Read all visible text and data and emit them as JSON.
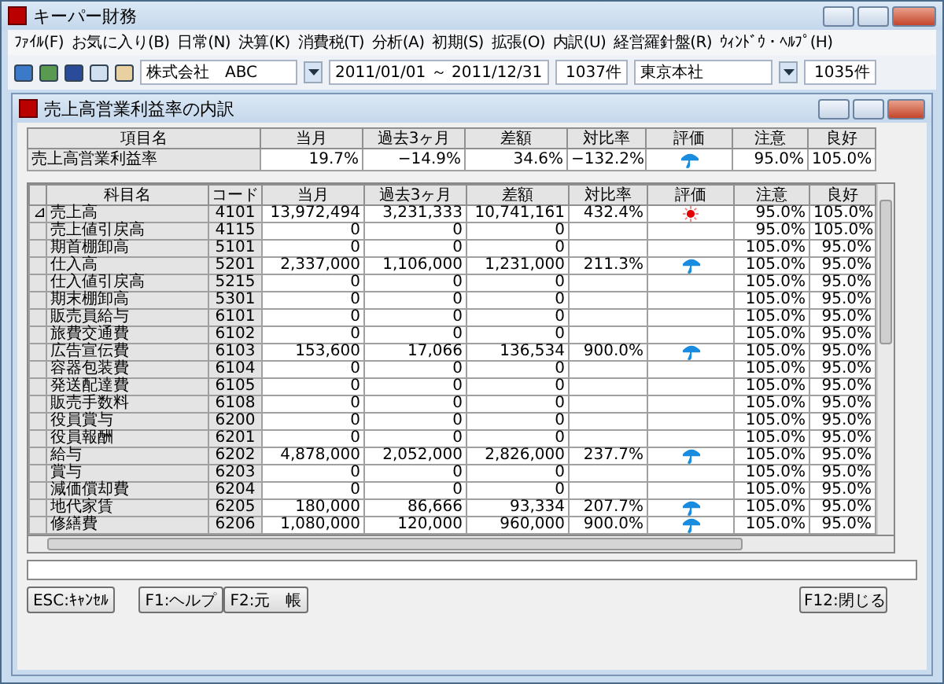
{
  "window": {
    "title": "キーパー財務"
  },
  "menu": [
    "ﾌｧｲﾙ(F)",
    "お気に入り(B)",
    "日常(N)",
    "決算(K)",
    "消費税(T)",
    "分析(A)",
    "初期(S)",
    "拡張(O)",
    "内訳(U)",
    "経営羅針盤(R)",
    "ｳｨﾝﾄﾞｳ・ﾍﾙﾌﾟ(H)"
  ],
  "toolbar": {
    "company": "株式会社　ABC",
    "period": "2011/01/01 ～ 2011/12/31",
    "count_1": "1037件",
    "branch": "東京本社",
    "count_2": "1035件"
  },
  "child_window": {
    "title": "売上高営業利益率の内訳"
  },
  "summary": {
    "columns": [
      "項目名",
      "当月",
      "過去3ヶ月",
      "差額",
      "対比率",
      "評価",
      "注意",
      "良好"
    ],
    "row": {
      "name": "売上高営業利益率",
      "current": "19.7%",
      "past3": "−14.9%",
      "diff": "34.6%",
      "ratio": "−132.2%",
      "kind": "rain",
      "caution": "95.0%",
      "good": "105.0%"
    }
  },
  "table": {
    "columns": [
      "科目名",
      "コード",
      "当月",
      "過去3ヶ月",
      "差額",
      "対比率",
      "評価",
      "注意",
      "良好"
    ],
    "rows": [
      {
        "marker": "⊿",
        "name": "売上高",
        "code": "4101",
        "current": "13,972,494",
        "past3": "3,231,333",
        "diff": "10,741,161",
        "ratio": "432.4%",
        "kind": "sun",
        "caution": "95.0%",
        "good": "105.0%"
      },
      {
        "name": "売上値引戻高",
        "code": "4115",
        "current": "0",
        "past3": "0",
        "diff": "0",
        "caution": "95.0%",
        "good": "105.0%"
      },
      {
        "name": "期首棚卸高",
        "code": "5101",
        "current": "0",
        "past3": "0",
        "diff": "0",
        "caution": "105.0%",
        "good": "95.0%"
      },
      {
        "name": "仕入高",
        "code": "5201",
        "current": "2,337,000",
        "past3": "1,106,000",
        "diff": "1,231,000",
        "ratio": "211.3%",
        "kind": "rain",
        "caution": "105.0%",
        "good": "95.0%"
      },
      {
        "name": "仕入値引戻高",
        "code": "5215",
        "current": "0",
        "past3": "0",
        "diff": "0",
        "caution": "105.0%",
        "good": "95.0%"
      },
      {
        "name": "期末棚卸高",
        "code": "5301",
        "current": "0",
        "past3": "0",
        "diff": "0",
        "caution": "105.0%",
        "good": "95.0%"
      },
      {
        "name": "販売員給与",
        "code": "6101",
        "current": "0",
        "past3": "0",
        "diff": "0",
        "caution": "105.0%",
        "good": "95.0%"
      },
      {
        "name": "旅費交通費",
        "code": "6102",
        "current": "0",
        "past3": "0",
        "diff": "0",
        "caution": "105.0%",
        "good": "95.0%"
      },
      {
        "name": "広告宣伝費",
        "code": "6103",
        "current": "153,600",
        "past3": "17,066",
        "diff": "136,534",
        "ratio": "900.0%",
        "kind": "rain",
        "caution": "105.0%",
        "good": "95.0%"
      },
      {
        "name": "容器包装費",
        "code": "6104",
        "current": "0",
        "past3": "0",
        "diff": "0",
        "caution": "105.0%",
        "good": "95.0%"
      },
      {
        "name": "発送配達費",
        "code": "6105",
        "current": "0",
        "past3": "0",
        "diff": "0",
        "caution": "105.0%",
        "good": "95.0%"
      },
      {
        "name": "販売手数料",
        "code": "6108",
        "current": "0",
        "past3": "0",
        "diff": "0",
        "caution": "105.0%",
        "good": "95.0%"
      },
      {
        "name": "役員賞与",
        "code": "6200",
        "current": "0",
        "past3": "0",
        "diff": "0",
        "caution": "105.0%",
        "good": "95.0%"
      },
      {
        "name": "役員報酬",
        "code": "6201",
        "current": "0",
        "past3": "0",
        "diff": "0",
        "caution": "105.0%",
        "good": "95.0%"
      },
      {
        "name": "給与",
        "code": "6202",
        "current": "4,878,000",
        "past3": "2,052,000",
        "diff": "2,826,000",
        "ratio": "237.7%",
        "kind": "rain",
        "caution": "105.0%",
        "good": "95.0%"
      },
      {
        "name": "賞与",
        "code": "6203",
        "current": "0",
        "past3": "0",
        "diff": "0",
        "caution": "105.0%",
        "good": "95.0%"
      },
      {
        "name": "減価償却費",
        "code": "6204",
        "current": "0",
        "past3": "0",
        "diff": "0",
        "caution": "105.0%",
        "good": "95.0%"
      },
      {
        "name": "地代家賃",
        "code": "6205",
        "current": "180,000",
        "past3": "86,666",
        "diff": "93,334",
        "ratio": "207.7%",
        "kind": "rain",
        "caution": "105.0%",
        "good": "95.0%"
      },
      {
        "name": "修繕費",
        "code": "6206",
        "current": "1,080,000",
        "past3": "120,000",
        "diff": "960,000",
        "ratio": "900.0%",
        "kind": "rain",
        "caution": "105.0%",
        "good": "95.0%"
      }
    ]
  },
  "buttons": [
    "ESC:ｷｬﾝｾﾙ",
    "F1:ヘルプ",
    "F2:元　帳",
    "F12:閉じる"
  ]
}
